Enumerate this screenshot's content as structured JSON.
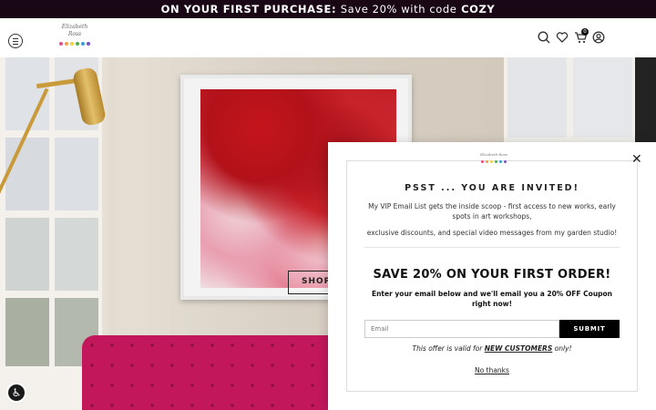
{
  "announcement": {
    "icon": "gift-icon",
    "icon_glyph": "",
    "lead": "ON YOUR FIRST PURCHASE:",
    "middle": "Save 20% with code",
    "code": "COZY"
  },
  "header": {
    "logo_text": "Elizabeth Ross",
    "logo_dot_colors": [
      "#e84c8b",
      "#f2a03d",
      "#f0d23c",
      "#4caf50",
      "#3aa0e0",
      "#7b4fc9"
    ],
    "cart_count": "0"
  },
  "hero": {
    "shop_label": "SHOP"
  },
  "accessibility": {
    "glyph": "♿"
  },
  "popup": {
    "close_glyph": "✕",
    "logo_text": "Elizabeth Ross",
    "title": "PSST ... YOU ARE INVITED!",
    "intro_line1": "My VIP Email List gets the inside scoop - first access to new works, early spots in art workshops,",
    "intro_line2": "exclusive discounts, and special video messages from my garden studio!",
    "offer_heading": "SAVE 20% ON YOUR FIRST ORDER!",
    "offer_sub": "Enter your email below and we'll email you a 20% OFF Coupon right now!",
    "email_placeholder": "Email",
    "submit_label": "SUBMIT",
    "valid_prefix": "This offer is valid for",
    "valid_highlight": "NEW CUSTOMERS",
    "valid_suffix": "only!",
    "no_thanks": "No thanks"
  }
}
